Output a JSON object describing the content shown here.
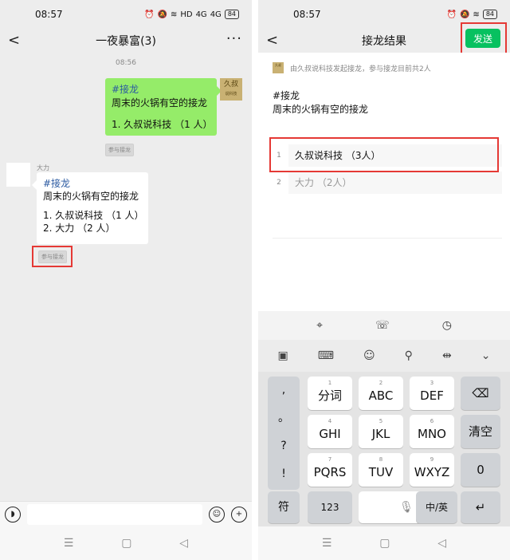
{
  "left": {
    "status": {
      "time": "08:57",
      "battery": "84",
      "signal1": "4G",
      "signal2": "4G",
      "hd": "HD"
    },
    "header": {
      "title": "一夜暴富(3)",
      "more": "···"
    },
    "timestamp": "08:56",
    "self_avatar": {
      "text": "久叔",
      "sub": "说科技"
    },
    "msg_self": {
      "tag": "#接龙",
      "line1": "周末的火锅有空的接龙",
      "line2": "1. 久叔说科技 （1 人）"
    },
    "join_label": "参与接龙",
    "other_name": "大力",
    "msg_other": {
      "tag": "#接龙",
      "line1": "周末的火锅有空的接龙",
      "line2": "1. 久叔说科技 （1 人）",
      "line3": "2. 大力 （2 人）"
    },
    "join_label2": "参与接龙"
  },
  "right": {
    "status": {
      "time": "08:57",
      "battery": "84"
    },
    "header": {
      "title": "接龙结果",
      "send": "发送"
    },
    "initiator": "由久叔说科技发起接龙，参与接龙目前共2人",
    "mini_logo": "久叔",
    "topic": {
      "tag": "#接龙",
      "line1": "周末的火锅有空的接龙"
    },
    "entries": [
      {
        "num": "1",
        "text": "久叔说科技 （3人）"
      },
      {
        "num": "2",
        "text": "大力 （2人）"
      }
    ],
    "keyboard": {
      "side": [
        ",",
        "。",
        "?",
        "!"
      ],
      "rows": [
        [
          {
            "d": "1",
            "l": "分词"
          },
          {
            "d": "2",
            "l": "ABC"
          },
          {
            "d": "3",
            "l": "DEF"
          }
        ],
        [
          {
            "d": "4",
            "l": "GHI"
          },
          {
            "d": "5",
            "l": "JKL"
          },
          {
            "d": "6",
            "l": "MNO"
          }
        ],
        [
          {
            "d": "7",
            "l": "PQRS"
          },
          {
            "d": "8",
            "l": "TUV"
          },
          {
            "d": "9",
            "l": "WXYZ"
          }
        ]
      ],
      "clear": "清空",
      "zero": "0",
      "fu": "符",
      "num123": "123",
      "lang": "中/英"
    }
  }
}
